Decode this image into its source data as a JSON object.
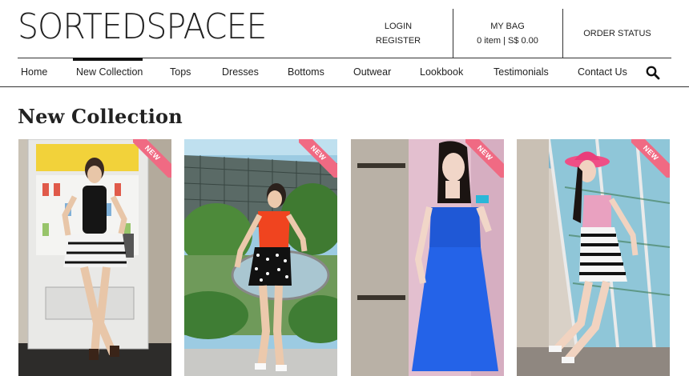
{
  "brand": {
    "logo_text": "SORTEDSPACEE"
  },
  "header": {
    "login_label": "LOGIN",
    "register_label": "REGISTER",
    "bag_label": "MY BAG",
    "bag_info": "0 item | S$ 0.00",
    "order_status_label": "ORDER STATUS"
  },
  "nav": {
    "items": [
      "Home",
      "New Collection",
      "Tops",
      "Dresses",
      "Bottoms",
      "Outwear",
      "Lookbook",
      "Testimonials",
      "Contact Us"
    ],
    "active": "New Collection"
  },
  "page": {
    "title": "New Collection"
  },
  "products": [
    {
      "badge": "NEW"
    },
    {
      "badge": "NEW"
    },
    {
      "badge": "NEW"
    },
    {
      "badge": "NEW"
    }
  ],
  "colors": {
    "badge": "#f06a83",
    "text": "#222222",
    "line": "#333333"
  }
}
